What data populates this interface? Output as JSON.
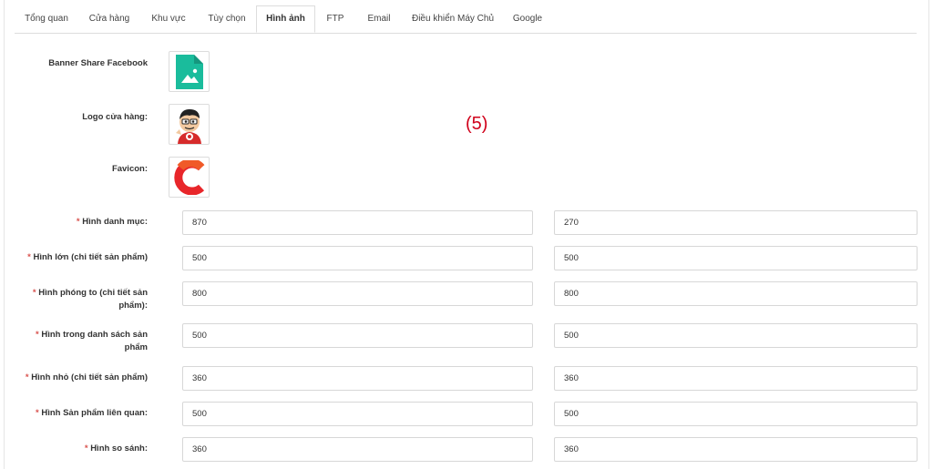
{
  "tabs": [
    {
      "label": "Tổng quan"
    },
    {
      "label": "Cửa hàng"
    },
    {
      "label": "Khu vực"
    },
    {
      "label": "Tùy chọn"
    },
    {
      "label": "Hình ảnh"
    },
    {
      "label": "FTP"
    },
    {
      "label": "Email"
    },
    {
      "label": "Điều khiển Máy Chủ"
    },
    {
      "label": "Google"
    }
  ],
  "active_tab": "Hình ảnh",
  "images": {
    "banner_label": "Banner Share Facebook",
    "logo_label": "Logo cửa hàng:",
    "favicon_label": "Favicon:"
  },
  "annotation": "(5)",
  "required_mark": "*",
  "sizes": [
    {
      "label": "Hình danh mục:",
      "width": "870",
      "height": "270"
    },
    {
      "label": "Hình lớn (chi tiết sản phẩm)",
      "width": "500",
      "height": "500"
    },
    {
      "label": "Hình phóng to (chi tiết sản phẩm):",
      "width": "800",
      "height": "800"
    },
    {
      "label": "Hình trong danh sách sản phẩm",
      "width": "500",
      "height": "500"
    },
    {
      "label": "Hình nhỏ (chi tiết sản phẩm)",
      "width": "360",
      "height": "360"
    },
    {
      "label": "Hình Sản phẩm liên quan:",
      "width": "500",
      "height": "500"
    },
    {
      "label": "Hình so sánh:",
      "width": "360",
      "height": "360"
    }
  ],
  "colors": {
    "required": "#d9534f",
    "annotation": "#d0021b",
    "placeholder_icon": "#1abc9c",
    "favicon": "#e8262a"
  }
}
